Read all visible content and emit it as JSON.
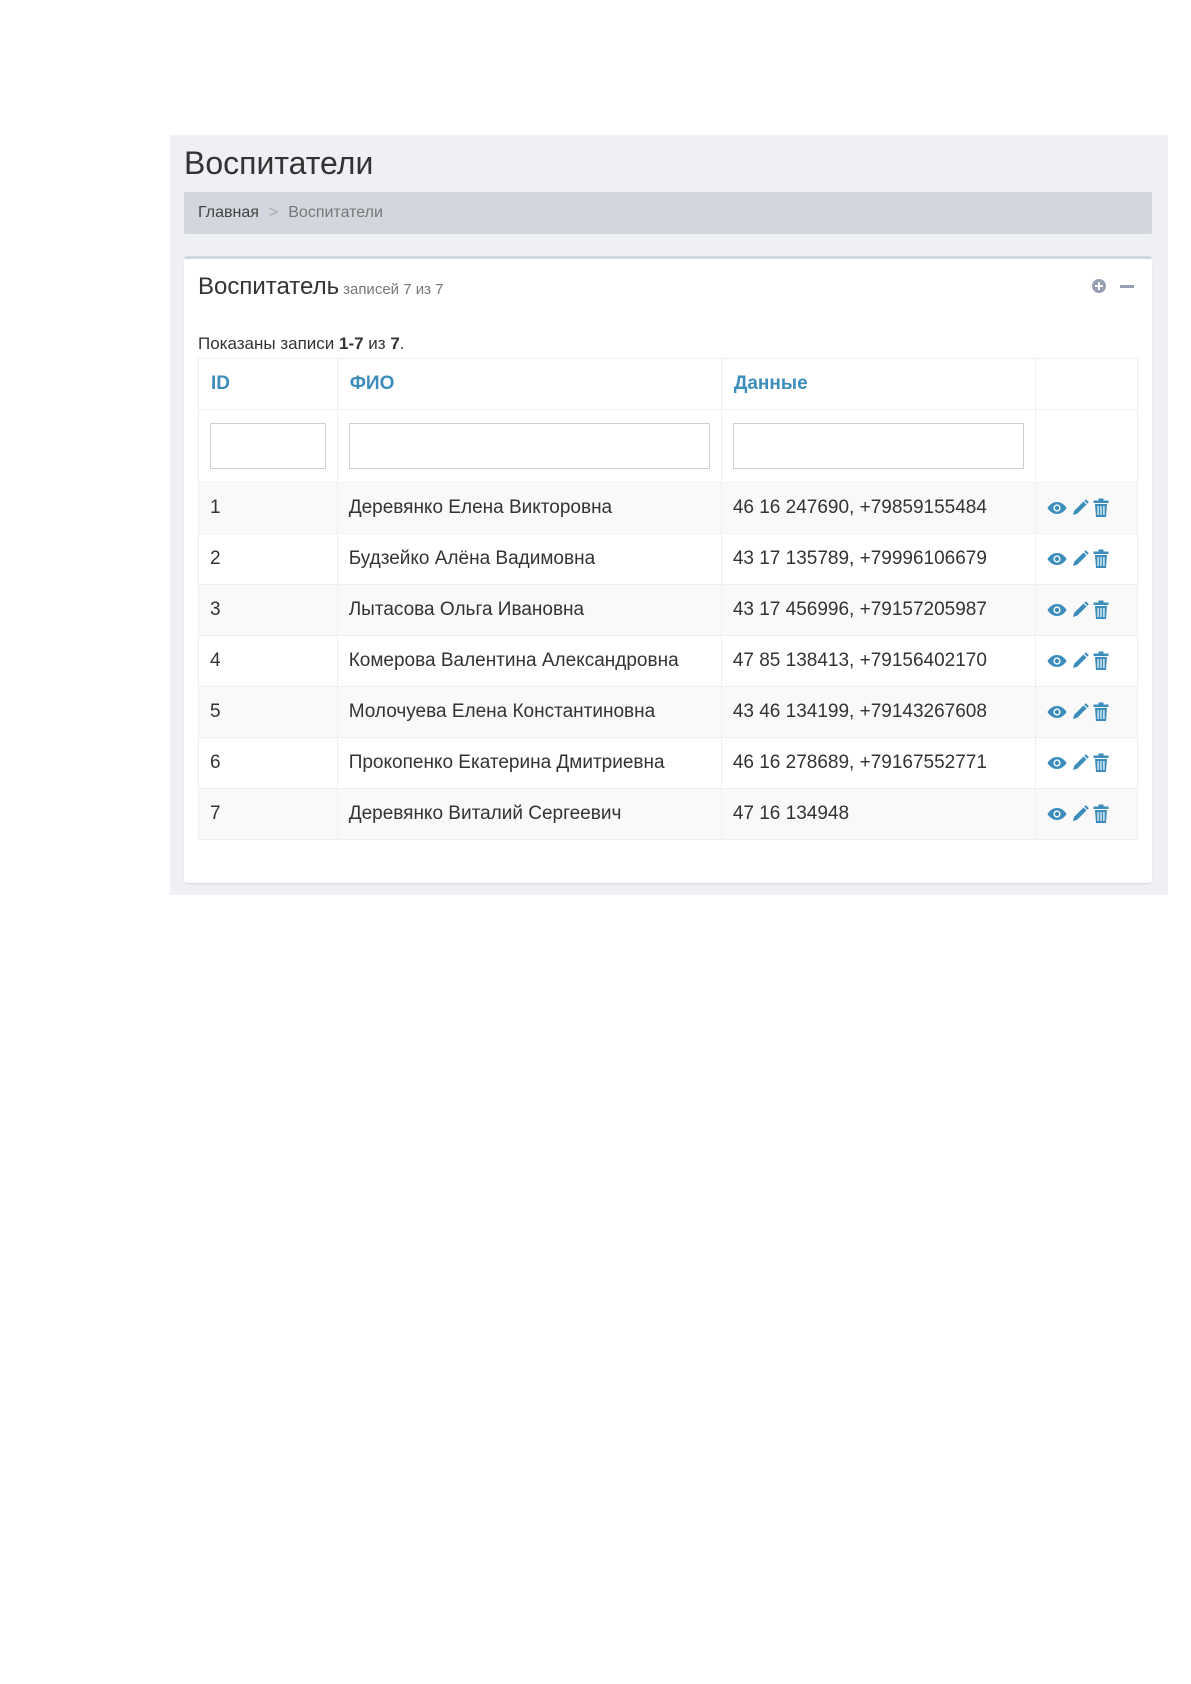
{
  "page": {
    "title": "Воспитатели"
  },
  "breadcrumb": {
    "home": "Главная",
    "separator": ">",
    "current": "Воспитатели"
  },
  "box": {
    "title": "Воспитатель",
    "subtitle": "записей 7 из 7",
    "tools": [
      "plus-circle-icon",
      "minus-icon"
    ]
  },
  "summary": {
    "prefix": "Показаны записи ",
    "range": "1-7",
    "middle": " из ",
    "total": "7",
    "suffix": "."
  },
  "table": {
    "headers": {
      "id": "ID",
      "fio": "ФИО",
      "data": "Данные",
      "actions": ""
    },
    "filters": {
      "id": "",
      "fio": "",
      "data": ""
    },
    "rows": [
      {
        "id": "1",
        "fio": "Деревянко Елена Викторовна",
        "data": "46 16 247690, +79859155484"
      },
      {
        "id": "2",
        "fio": "Будзейко Алёна Вадимовна",
        "data": "43 17 135789, +79996106679"
      },
      {
        "id": "3",
        "fio": "Лытасова Ольга Ивановна",
        "data": "43 17 456996, +79157205987"
      },
      {
        "id": "4",
        "fio": "Комерова Валентина Александровна",
        "data": "47 85 138413, +79156402170"
      },
      {
        "id": "5",
        "fio": "Молочуева Елена Константиновна",
        "data": "43 46 134199, +79143267608"
      },
      {
        "id": "6",
        "fio": "Прокопенко Екатерина Дмитриевна",
        "data": "46 16 278689, +79167552771"
      },
      {
        "id": "7",
        "fio": "Деревянко Виталий Сергеевич",
        "data": "47 16 134948"
      }
    ],
    "row_actions": [
      "eye-icon",
      "pencil-icon",
      "trash-icon"
    ]
  },
  "colors": {
    "accent": "#3c8dbc",
    "content_bg": "#eef0f4",
    "breadcrumb_bg": "#d2d6de",
    "tool_icon": "#97a0b3"
  }
}
